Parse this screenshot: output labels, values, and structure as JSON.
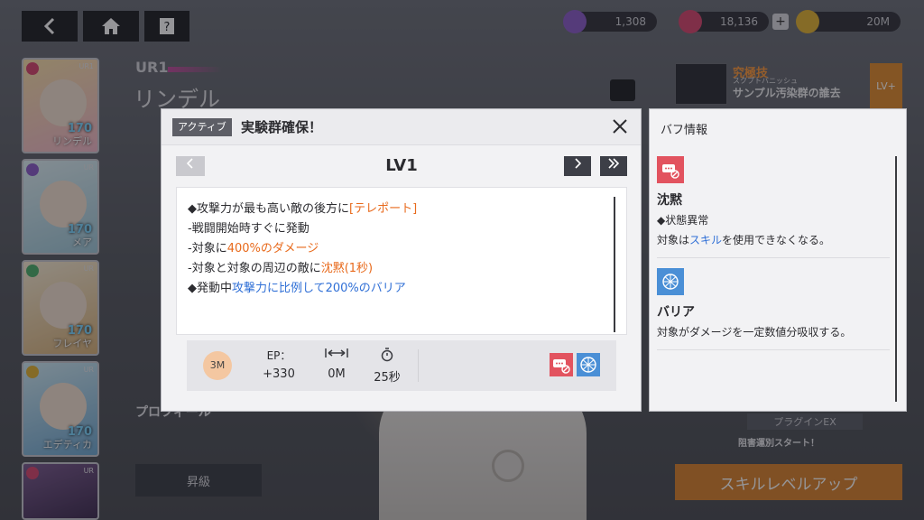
{
  "top_bar": {
    "back_icon": "back-arrow-icon",
    "home_icon": "home-icon",
    "help_icon": "help-icon",
    "currencies": [
      {
        "icon": "gem-icon",
        "value": "1,308",
        "color": "#8a5cc8"
      },
      {
        "icon": "heart-ticket-icon",
        "value": "18,136",
        "color": "#d8456e"
      },
      {
        "icon": "gold-coin-icon",
        "value": "20M",
        "color": "#e2b232"
      }
    ]
  },
  "background": {
    "rank": "UR1",
    "character_name": "リンデル",
    "profile_label": "プロフィール",
    "upgrade_label": "昇級",
    "skill_level_up_label": "スキルレベルアップ",
    "ultimate_label": "究極技",
    "ultimate_skill_name": "スクプトバニッシュ",
    "ultimate_name": "サンプル汚染群の誰去",
    "ultimate_level_badge": "LV+",
    "plugin_label": "プラグインEX",
    "plugin_desc": "阻害運別スタート！",
    "characters": [
      {
        "name": "リンデル",
        "level": "170",
        "tag": "UR1",
        "color": "#f4d28a"
      },
      {
        "name": "メア",
        "level": "170",
        "tag": "UR",
        "color": "#b9dfe8"
      },
      {
        "name": "フレイヤ",
        "level": "170",
        "tag": "UR",
        "color": "#f0c58a"
      },
      {
        "name": "エデティカ",
        "level": "170",
        "tag": "UR",
        "color": "#9fd0e8"
      },
      {
        "name": "",
        "level": "",
        "tag": "UR",
        "color": "#6a4a7e"
      }
    ]
  },
  "skill_dialog": {
    "type_badge": "アクティブ",
    "title": "実験群確保！",
    "close_icon": "close-icon",
    "level_label": "LV1",
    "prev_icon": "chevron-left-icon",
    "next_icon": "chevron-right-icon",
    "last_icon": "double-chevron-right-icon",
    "description": [
      {
        "prefix": "◆攻撃力が最も高い敵の後方に",
        "highlight": "[テレポート]",
        "suffix": "",
        "color": "orange"
      },
      {
        "prefix": "-戦闘開始時すぐに発動",
        "highlight": "",
        "suffix": "",
        "color": ""
      },
      {
        "prefix": "-対象に",
        "highlight": "400%のダメージ",
        "suffix": "",
        "color": "orange"
      },
      {
        "prefix": "-対象と対象の周辺の敵に",
        "highlight": "沈黙(1秒)",
        "suffix": "",
        "color": "orange"
      },
      {
        "prefix": "◆発動中",
        "highlight": "攻撃力に比例して200%のバリア",
        "suffix": "",
        "color": "blue"
      }
    ],
    "stats": {
      "range_badge": "3M",
      "ep_label": "EP：",
      "ep_value": "+330",
      "distance_icon": "dash-distance-icon",
      "distance_value": "0M",
      "cooldown_icon": "stopwatch-icon",
      "cooldown_value": "25秒"
    },
    "buff_icons": [
      "silence-icon",
      "barrier-icon"
    ]
  },
  "buff_panel": {
    "title": "バフ情報",
    "buffs": [
      {
        "icon": "silence-icon",
        "name": "沈黙",
        "category": "◆状態異常",
        "text_prefix": "対象は",
        "text_highlight": "スキル",
        "text_suffix": "を使用できなくなる。",
        "color": "#e2535f"
      },
      {
        "icon": "barrier-icon",
        "name": "バリア",
        "category": "",
        "text_prefix": "対象がダメージを一定数値分吸収する。",
        "text_highlight": "",
        "text_suffix": "",
        "color": "#4a8fd6"
      }
    ]
  }
}
